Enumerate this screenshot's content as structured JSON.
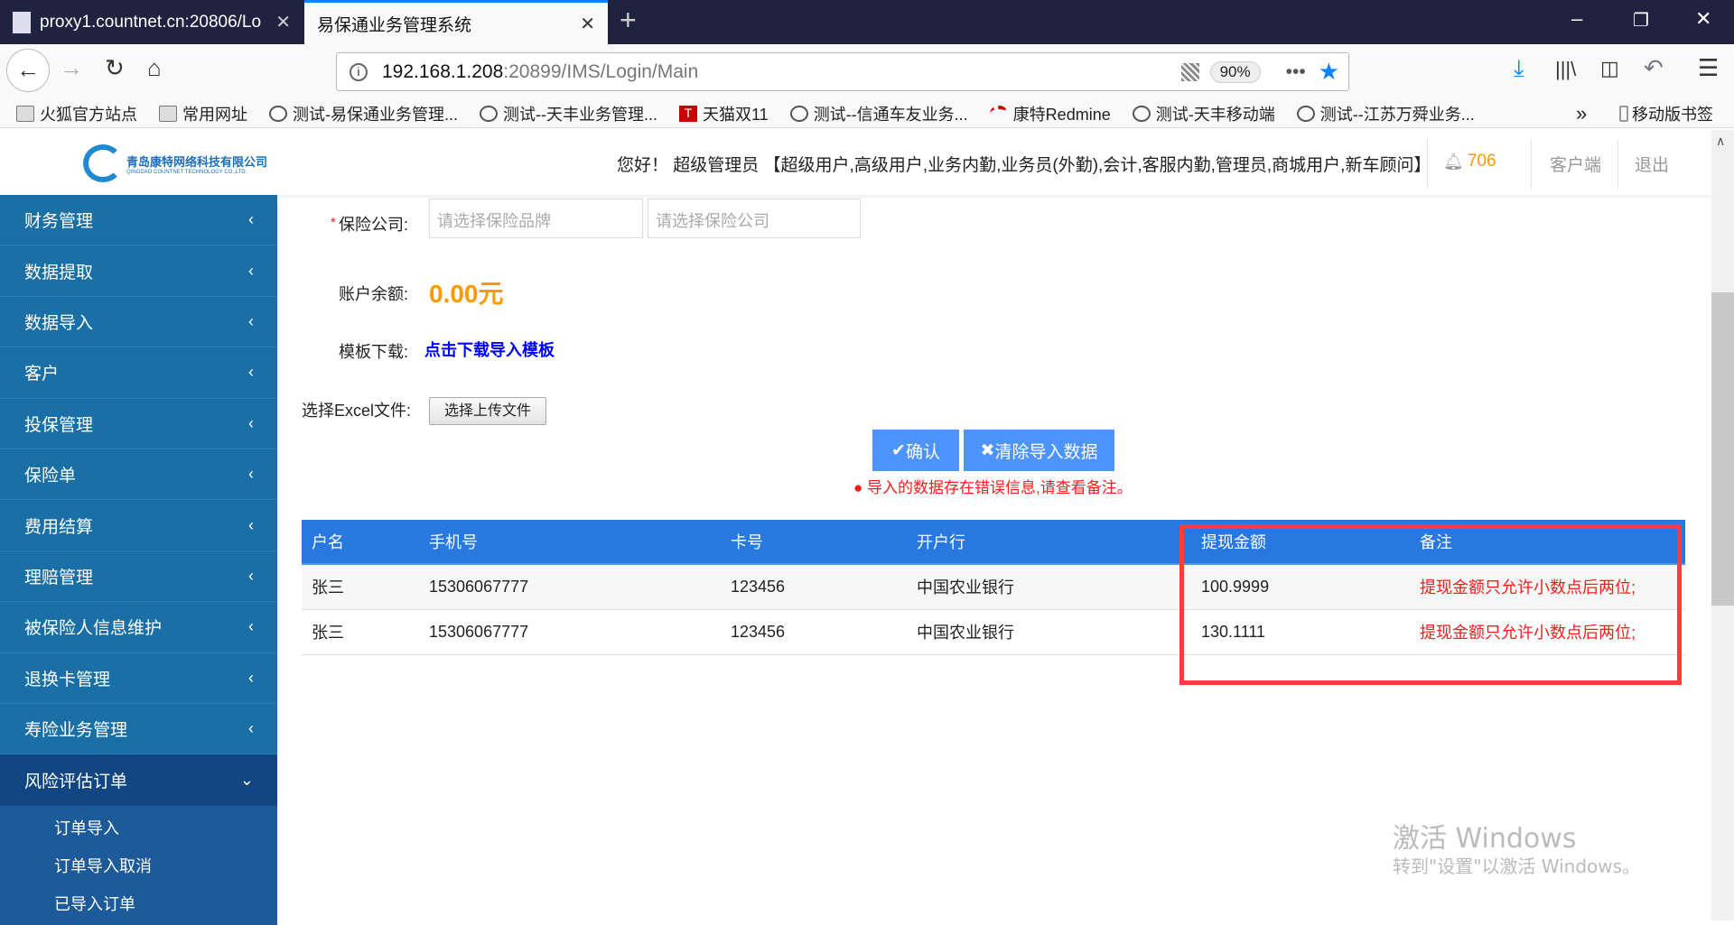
{
  "browser": {
    "tabs": [
      {
        "label": "proxy1.countnet.cn:20806/Lo"
      },
      {
        "label": "易保通业务管理系统"
      }
    ],
    "url_host": "192.168.1.208",
    "url_rest": ":20899/IMS/Login/Main",
    "zoom": "90%",
    "bookmarks": [
      {
        "label": "火狐官方站点",
        "icon": "folder-icon"
      },
      {
        "label": "常用网址",
        "icon": "folder-icon"
      },
      {
        "label": "测试-易保通业务管理...",
        "icon": "globe-icon"
      },
      {
        "label": "测试--天丰业务管理...",
        "icon": "globe-icon"
      },
      {
        "label": "天猫双11",
        "icon": "tmall-icon"
      },
      {
        "label": "测试--信通车友业务...",
        "icon": "globe-icon"
      },
      {
        "label": "康特Redmine",
        "icon": "redmine-icon"
      },
      {
        "label": "测试-天丰移动端",
        "icon": "globe-icon"
      },
      {
        "label": "测试--江苏万舜业务...",
        "icon": "globe-icon"
      }
    ],
    "mobile_bookmarks": "移动版书签"
  },
  "header": {
    "logo_cn": "青岛康特网络科技有限公司",
    "logo_en": "QINGDAO COUNTNET TECHNOLOGY CO.,LTD.",
    "greeting": "您好！ 超级管理员 【超级用户,高级用户,业务内勤,业务员(外勤),会计,客服内勤,管理员,商城用户,新车顾问】",
    "notifications": "706",
    "client": "客户端",
    "logout": "退出"
  },
  "sidebar": {
    "items": [
      {
        "label": "财务管理"
      },
      {
        "label": "数据提取"
      },
      {
        "label": "数据导入"
      },
      {
        "label": "客户"
      },
      {
        "label": "投保管理"
      },
      {
        "label": "保险单"
      },
      {
        "label": "费用结算"
      },
      {
        "label": "理赔管理"
      },
      {
        "label": "被保险人信息维护"
      },
      {
        "label": "退换卡管理"
      },
      {
        "label": "寿险业务管理"
      }
    ],
    "open": {
      "label": "风险评估订单",
      "children": [
        {
          "label": "订单导入"
        },
        {
          "label": "订单导入取消"
        },
        {
          "label": "已导入订单"
        }
      ]
    }
  },
  "form": {
    "company_label": "保险公司:",
    "required": "*",
    "brand_placeholder": "请选择保险品牌",
    "company_placeholder": "请选择保险公司",
    "balance_label": "账户余额:",
    "balance": "0.00元",
    "template_label": "模板下载:",
    "template_link": "点击下载导入模板",
    "file_label": "选择Excel文件:",
    "file_button": "选择上传文件",
    "confirm": "确认",
    "clear": "清除导入数据",
    "error": "导入的数据存在错误信息,请查看备注。"
  },
  "table": {
    "columns": [
      "户名",
      "手机号",
      "卡号",
      "开户行",
      "提现金额",
      "备注"
    ],
    "rows": [
      [
        "张三",
        "15306067777",
        "123456",
        "中国农业银行",
        "100.9999",
        "提现金额只允许小数点后两位;"
      ],
      [
        "张三",
        "15306067777",
        "123456",
        "中国农业银行",
        "130.1111",
        "提现金额只允许小数点后两位;"
      ]
    ]
  },
  "watermark": {
    "title": "激活 Windows",
    "sub": "转到\"设置\"以激活 Windows。"
  },
  "colors": {
    "sidebar": "#1a70a6",
    "table_header": "#2878e0",
    "button": "#4d94ff",
    "balance": "#ff9900",
    "link": "#0000ff",
    "error": "#ff1a1a"
  }
}
